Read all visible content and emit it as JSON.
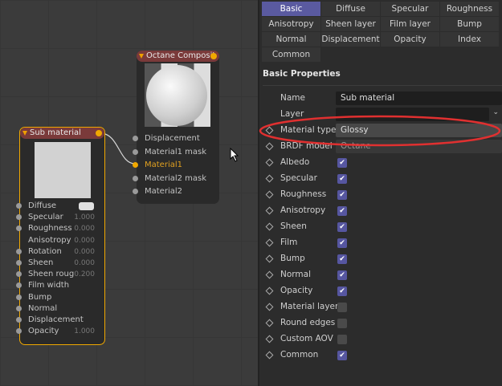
{
  "composite_node": {
    "title": "Octane Composit",
    "inputs": [
      {
        "label": "Displacement",
        "active": false
      },
      {
        "label": "Material1 mask",
        "active": false
      },
      {
        "label": "Material1",
        "active": true
      },
      {
        "label": "Material2 mask",
        "active": false
      },
      {
        "label": "Material2",
        "active": false
      }
    ]
  },
  "sub_node": {
    "title": "Sub material",
    "rows": [
      {
        "label": "Diffuse",
        "value": "",
        "socket": true,
        "swatch": true
      },
      {
        "label": "Specular",
        "value": "1.000",
        "socket": true
      },
      {
        "label": "Roughness",
        "value": "0.000",
        "socket": true
      },
      {
        "label": "Anisotropy",
        "value": "0.000",
        "socket": false
      },
      {
        "label": "Rotation",
        "value": "0.000",
        "socket": true
      },
      {
        "label": "Sheen",
        "value": "0.000",
        "socket": true
      },
      {
        "label": "Sheen roug",
        "value": "0.200",
        "socket": true
      },
      {
        "label": "Film width",
        "value": "",
        "socket": true
      },
      {
        "label": "Bump",
        "value": "",
        "socket": true
      },
      {
        "label": "Normal",
        "value": "",
        "socket": true
      },
      {
        "label": "Displacement",
        "value": "",
        "socket": true
      },
      {
        "label": "Opacity",
        "value": "1.000",
        "socket": true
      }
    ]
  },
  "tabs": [
    "Basic",
    "Diffuse",
    "Specular",
    "Roughness",
    "Anisotropy",
    "Sheen layer",
    "Film layer",
    "Bump",
    "Normal",
    "Displacement",
    "Opacity",
    "Index",
    "Common"
  ],
  "active_tab": "Basic",
  "section_title": "Basic Properties",
  "fields": {
    "name_label": "Name",
    "name_value": "Sub material",
    "layer_label": "Layer",
    "layer_value": "",
    "material_type_label": "Material type",
    "material_type_value": "Glossy",
    "brdf_label": "BRDF model",
    "brdf_value": "Octane"
  },
  "checkboxes": [
    {
      "label": "Albedo",
      "checked": true
    },
    {
      "label": "Specular",
      "checked": true
    },
    {
      "label": "Roughness",
      "checked": true
    },
    {
      "label": "Anisotropy",
      "checked": true
    },
    {
      "label": "Sheen",
      "checked": true
    },
    {
      "label": "Film",
      "checked": true
    },
    {
      "label": "Bump",
      "checked": true
    },
    {
      "label": "Normal",
      "checked": true
    },
    {
      "label": "Opacity",
      "checked": true
    },
    {
      "label": "Material layer",
      "checked": false
    },
    {
      "label": "Round edges",
      "checked": false
    },
    {
      "label": "Custom AOV",
      "checked": false
    },
    {
      "label": "Common",
      "checked": true
    }
  ],
  "colors": {
    "accent": "#5a5aa0",
    "node_header": "#7a3a3a",
    "selected_outline": "#f0a800",
    "highlight": "#e03030"
  }
}
